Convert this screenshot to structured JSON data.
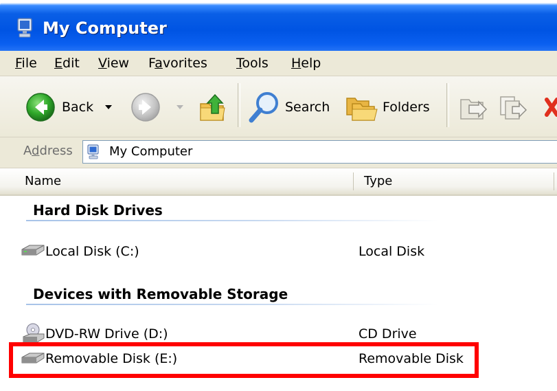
{
  "window": {
    "title": "My Computer",
    "title_icon": "my-computer-icon"
  },
  "menu": {
    "items": [
      {
        "label": "File",
        "accesskey": "F"
      },
      {
        "label": "Edit",
        "accesskey": "E"
      },
      {
        "label": "View",
        "accesskey": "V"
      },
      {
        "label": "Favorites",
        "accesskey": "a"
      },
      {
        "label": "Tools",
        "accesskey": "T"
      },
      {
        "label": "Help",
        "accesskey": "H"
      }
    ]
  },
  "toolbar": {
    "back_label": "Back",
    "search_label": "Search",
    "folders_label": "Folders",
    "back_icon": "back-arrow-icon",
    "forward_icon": "forward-arrow-icon",
    "up_icon": "up-folder-icon",
    "search_icon": "search-icon",
    "folders_icon": "folders-icon",
    "move_icon": "move-to-icon",
    "copy_icon": "copy-to-icon",
    "delete_icon": "delete-icon"
  },
  "address": {
    "label": "Address",
    "value": "My Computer",
    "icon": "my-computer-icon"
  },
  "columns": {
    "name": "Name",
    "type": "Type"
  },
  "groups": [
    {
      "title": "Hard Disk Drives",
      "items": [
        {
          "name": "Local Disk (C:)",
          "type": "Local Disk",
          "icon": "hard-drive-icon"
        }
      ]
    },
    {
      "title": "Devices with Removable Storage",
      "items": [
        {
          "name": "DVD-RW Drive (D:)",
          "type": "CD Drive",
          "icon": "dvd-drive-icon"
        },
        {
          "name": "Removable Disk (E:)",
          "type": "Removable Disk",
          "icon": "removable-disk-icon"
        }
      ]
    }
  ],
  "colors": {
    "titlebar": "#0054e3",
    "chrome": "#ece9d8",
    "highlight": "#ff0000",
    "group_rule": "#a7c3e8"
  }
}
